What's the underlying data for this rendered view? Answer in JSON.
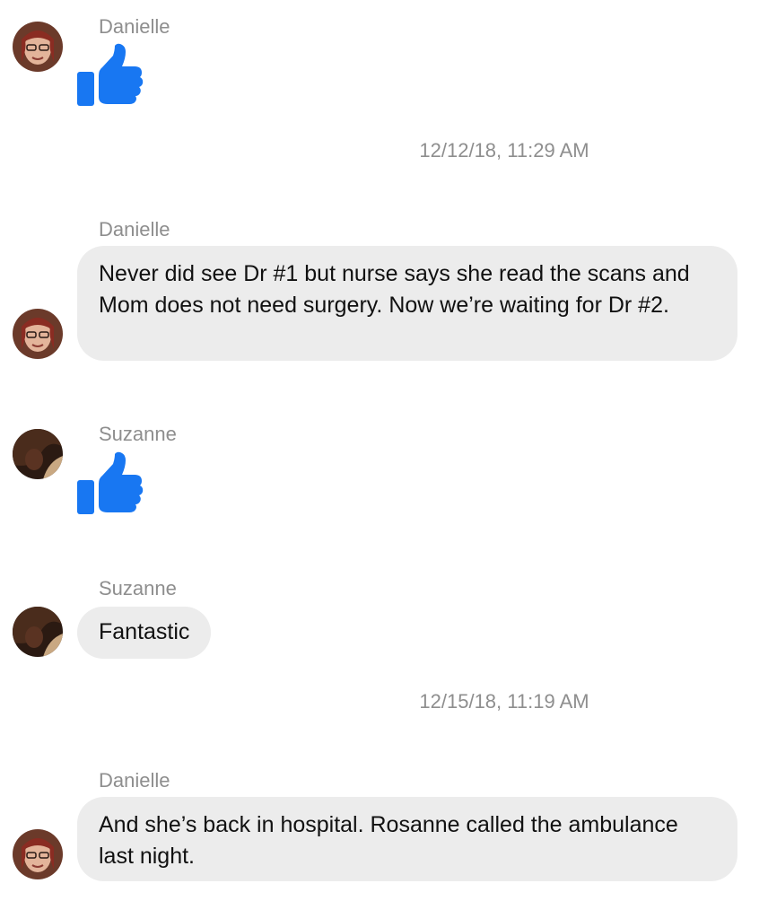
{
  "colors": {
    "like_blue": "#1877f2",
    "bubble_gray": "#ececec",
    "meta_text": "#8e8e8e"
  },
  "conversation": {
    "messages": [
      {
        "sender": "Danielle",
        "type": "like",
        "icon": "thumbs-up-icon"
      },
      {
        "timestamp": "12/12/18, 11:29 AM"
      },
      {
        "sender": "Danielle",
        "type": "text",
        "text": "Never did see Dr #1 but nurse says she read the scans and Mom does not need surgery. Now we’re waiting for Dr #2."
      },
      {
        "sender": "Suzanne",
        "type": "like",
        "icon": "thumbs-up-icon"
      },
      {
        "sender": "Suzanne",
        "type": "text",
        "text": "Fantastic"
      },
      {
        "timestamp": "12/15/18, 11:19 AM"
      },
      {
        "sender": "Danielle",
        "type": "text",
        "text": "And she’s back in hospital. Rosanne called the ambulance last night."
      }
    ]
  }
}
